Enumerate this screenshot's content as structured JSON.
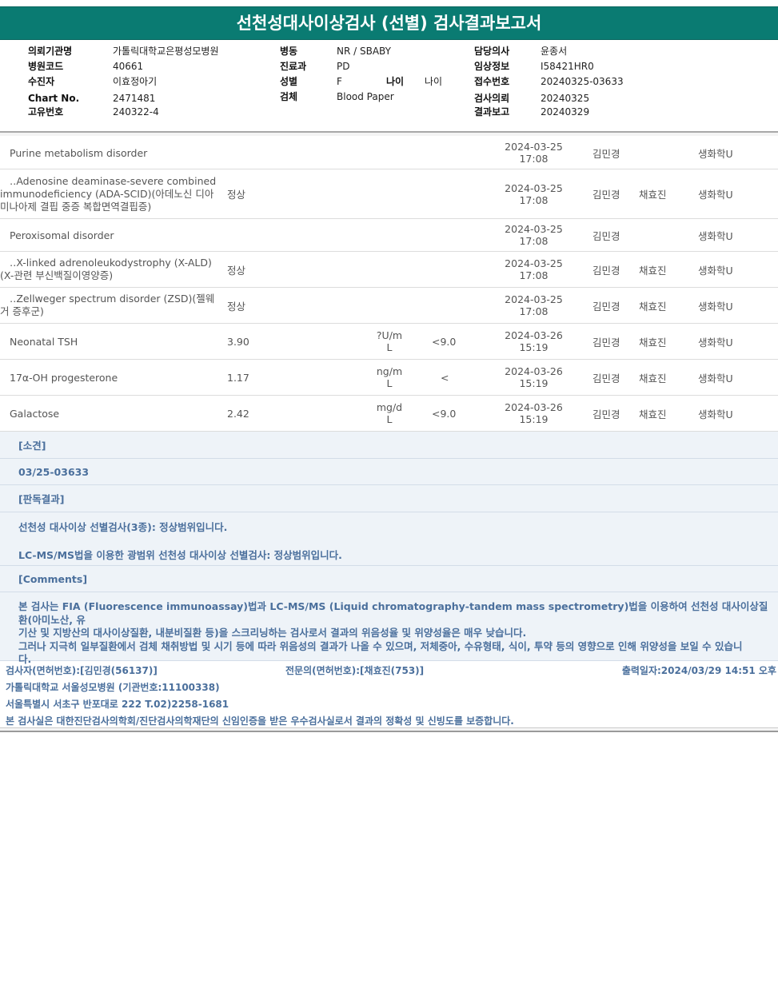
{
  "report_title": "선천성대사이상검사 (선별) 검사결과보고서",
  "header": {
    "institution_label": "의뢰기관명",
    "institution": "가톨릭대학교은평성모병원",
    "hospital_code_label": "병원코드",
    "hospital_code": "40661",
    "patient_label": "수진자",
    "patient": "이효정아기",
    "chart_label": "Chart No.",
    "chart_no": "2471481",
    "unique_label": "고유번호",
    "unique_no": "240322-4",
    "ward_label": "병동",
    "ward": "NR / SBABY",
    "dept_label": "진료과",
    "dept": "PD",
    "sex_label": "성별",
    "sex": "F",
    "age_label": "나이",
    "age": "나이",
    "specimen_label": "검체",
    "specimen": "Blood Paper",
    "doctor_label": "담당의사",
    "doctor": "윤종서",
    "clinical_label": "임상정보",
    "clinical": "I58421HR0",
    "receipt_label": "접수번호",
    "receipt": "20240325-03633",
    "request_label": "검사의뢰",
    "request_date": "20240325",
    "report_label": "결과보고",
    "report_date": "20240329"
  },
  "results": [
    {
      "name": [
        "Purine metabolism disorder"
      ],
      "result": "",
      "unit": [],
      "ref": "",
      "date": [
        "2024-03-25",
        "17:08"
      ],
      "tester": "김민경",
      "doctor": "",
      "dept": "생화학U"
    },
    {
      "name": [
        "‥Adenosine deaminase-severe combined",
        "immunodeficiency (ADA-SCID)(아데노신 디아",
        "미나아제 결핍 중증 복합면역결핍증)"
      ],
      "result": "정상",
      "unit": [],
      "ref": "",
      "date": [
        "2024-03-25",
        "17:08"
      ],
      "tester": "김민경",
      "doctor": "채효진",
      "dept": "생화학U"
    },
    {
      "name": [
        "Peroxisomal disorder"
      ],
      "result": "",
      "unit": [],
      "ref": "",
      "date": [
        "2024-03-25",
        "17:08"
      ],
      "tester": "김민경",
      "doctor": "",
      "dept": "생화학U"
    },
    {
      "name": [
        "‥X-linked adrenoleukodystrophy (X-ALD)",
        "(X-관련 부신백질이영양증)"
      ],
      "result": "정상",
      "unit": [],
      "ref": "",
      "date": [
        "2024-03-25",
        "17:08"
      ],
      "tester": "김민경",
      "doctor": "채효진",
      "dept": "생화학U"
    },
    {
      "name": [
        "‥Zellweger spectrum disorder (ZSD)(젤웨",
        "거 증후군)"
      ],
      "result": "정상",
      "unit": [],
      "ref": "",
      "date": [
        "2024-03-25",
        "17:08"
      ],
      "tester": "김민경",
      "doctor": "채효진",
      "dept": "생화학U"
    },
    {
      "name": [
        "Neonatal TSH"
      ],
      "result": "3.90",
      "unit": [
        "?U/m",
        "L"
      ],
      "ref": "<9.0",
      "date": [
        "2024-03-26",
        "15:19"
      ],
      "tester": "김민경",
      "doctor": "채효진",
      "dept": "생화학U"
    },
    {
      "name": [
        "17α-OH progesterone"
      ],
      "result": "1.17",
      "unit": [
        "ng/m",
        "L"
      ],
      "ref": "<",
      "date": [
        "2024-03-26",
        "15:19"
      ],
      "tester": "김민경",
      "doctor": "채효진",
      "dept": "생화학U"
    },
    {
      "name": [
        "Galactose"
      ],
      "result": "2.42",
      "unit": [
        "mg/d",
        "L"
      ],
      "ref": "<9.0",
      "date": [
        "2024-03-26",
        "15:19"
      ],
      "tester": "김민경",
      "doctor": "채효진",
      "dept": "생화학U"
    }
  ],
  "notes": {
    "opinion_heading": "[소견]",
    "opinion": "03/25-03633",
    "reading_heading": "[판독결과]",
    "reading_1": "선천성 대사이상 선별검사(3종): 정상범위입니다.",
    "reading_2": "LC-MS/MS법을 이용한 광범위 선천성 대사이상 선별검사: 정상범위입니다.",
    "comments_heading": "[Comments]",
    "comments_lines": [
      "본 검사는 FIA (Fluorescence immunoassay)법과 LC-MS/MS (Liquid chromatography-tandem mass spectrometry)법을 이용하여 선천성 대사이상질환(아미노산, 유",
      "기산 및 지방산의 대사이상질환, 내분비질환 등)을 스크리닝하는 검사로서 결과의 위음성율 및 위양성율은 매우 낮습니다.",
      "그러나 지극히 일부질환에서 검체 채취방법 및 시기 등에 따라 위음성의 결과가 나올 수 있으며, 저체중아, 수유형태, 식이, 투약 등의 영향으로 인해 위양성을 보일 수 있습니",
      "다."
    ]
  },
  "footer": {
    "tester": "검사자(면허번호):[김민경(56137)]",
    "specialist": "전문의(면허번호):[채효진(753)]",
    "printed": "출력일자:2024/03/29 14:51 오후",
    "hospital": "가톨릭대학교 서울성모병원 (기관번호:11100338)",
    "address": "서울특별시 서초구 반포대로 222 T.02)2258-1681",
    "cert": "본 검사실은 대한진단검사의학회/진단검사의학재단의 신임인증을 받은 우수검사실로서 결과의 정확성 및 신빙도를 보증합니다."
  }
}
